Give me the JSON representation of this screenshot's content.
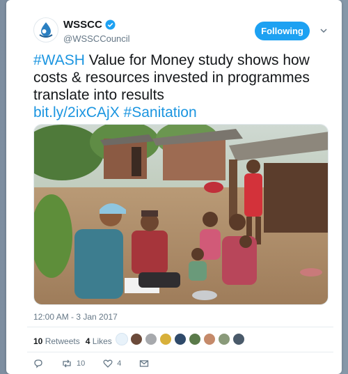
{
  "account": {
    "name": "WSSCC",
    "handle": "@WSSCCouncil"
  },
  "follow_label": "Following",
  "tweet": {
    "hashtag_wash": "#WASH",
    "text_part1": " Value for Money study shows how costs & resources invested in programmes translate into results",
    "link": "bit.ly/2ixCAjX",
    "hashtag_sanitation": "#Sanitation"
  },
  "timestamp": "12:00 AM - 3 Jan 2017",
  "stats": {
    "retweets_count": "10",
    "retweets_label": "Retweets",
    "likes_count": "4",
    "likes_label": "Likes"
  },
  "actions": {
    "retweet_count": "10",
    "like_count": "4"
  },
  "colors": {
    "accent": "#1da1f2",
    "link": "#1b95e0",
    "text": "#14171a",
    "muted": "#657786"
  },
  "icons": [
    "verified-badge-icon",
    "chevron-down-icon",
    "reply-icon",
    "retweet-icon",
    "heart-icon",
    "message-icon"
  ]
}
